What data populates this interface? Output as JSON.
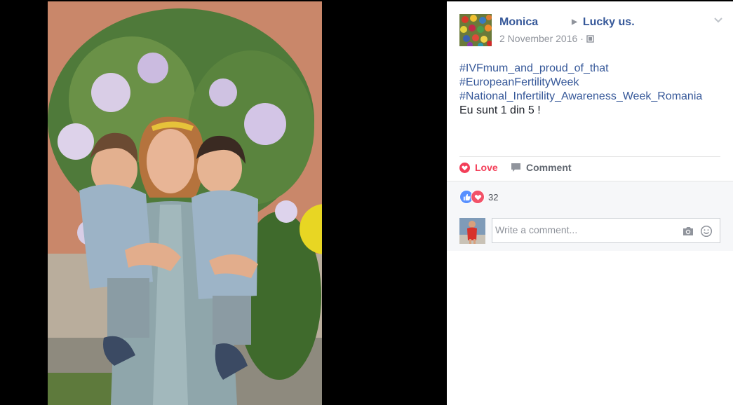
{
  "post": {
    "author": "Monica",
    "target": "Lucky us.",
    "date": "2 November 2016",
    "date_separator": "·",
    "audience_icon": "globe-icon",
    "options_icon": "chevron-down-icon",
    "text_lines": [
      {
        "text": "#IVFmum_and_proud_of_that",
        "type": "hashtag"
      },
      {
        "text": "#EuropeanFertilityWeek",
        "type": "hashtag"
      },
      {
        "text": "#National_Infertility_Awareness_Week_Romania",
        "type": "hashtag"
      },
      {
        "text": "Eu sunt 1 din 5 !",
        "type": "text"
      }
    ]
  },
  "actions": {
    "love_label": "Love",
    "comment_label": "Comment",
    "love_icon": "heart-icon",
    "comment_icon": "speech-bubble-icon"
  },
  "reactions": {
    "count": "32",
    "icons": [
      "like-icon",
      "heart-icon"
    ]
  },
  "comment_box": {
    "placeholder": "Write a comment...",
    "camera_icon": "camera-icon",
    "emoji_icon": "smiley-icon"
  },
  "colors": {
    "link": "#365899",
    "love": "#f33e58",
    "like_blue": "#5890ff",
    "heart_red": "#f25268",
    "muted": "#90949c"
  }
}
